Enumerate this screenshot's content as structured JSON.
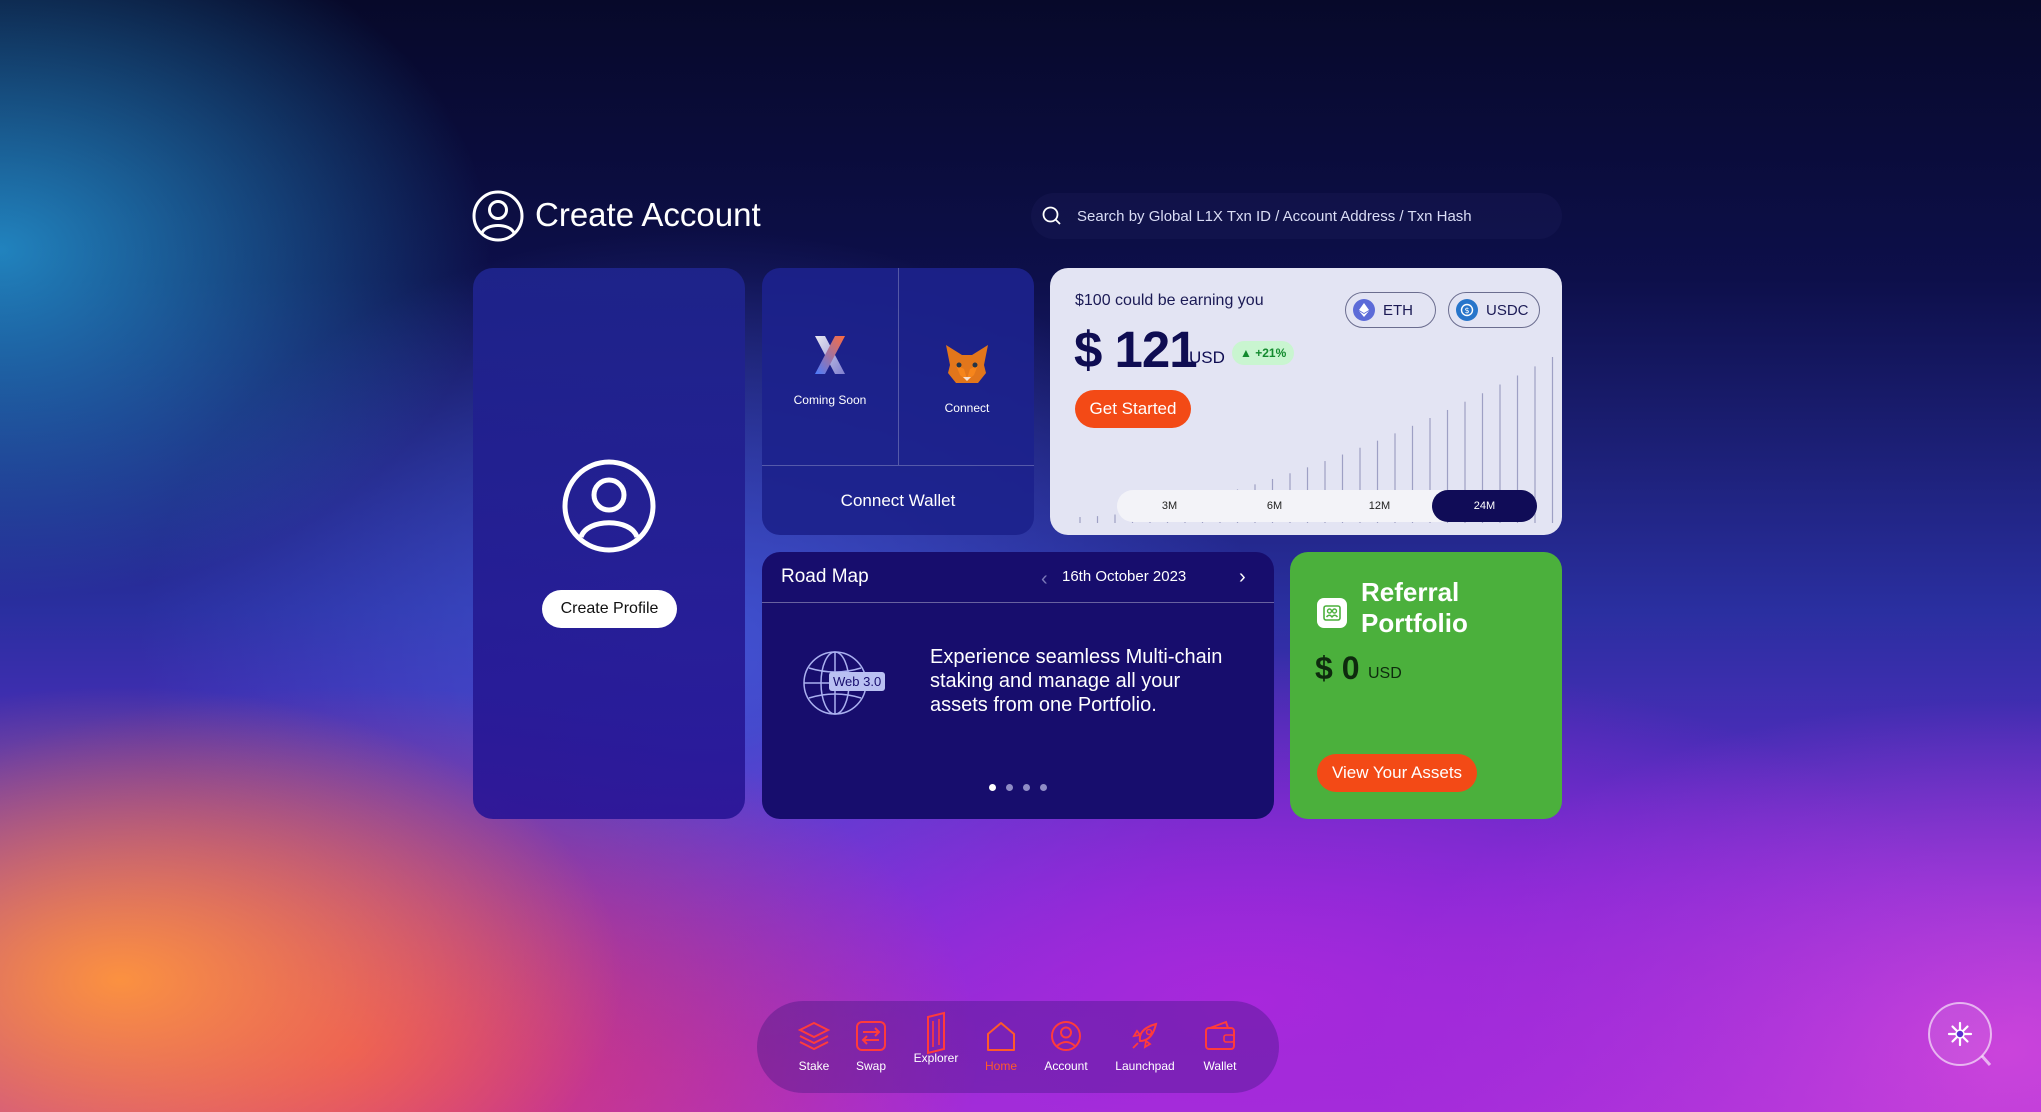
{
  "header": {
    "title": "Create Account",
    "search_placeholder": "Search by Global L1X Txn ID / Account Address / Txn Hash"
  },
  "profile_card": {
    "button_label": "Create Profile"
  },
  "wallet_card": {
    "options": [
      {
        "label": "Coming Soon",
        "icon": "l1x-logo-icon"
      },
      {
        "label": "Connect",
        "icon": "metamask-fox-icon"
      }
    ],
    "connect_label": "Connect Wallet"
  },
  "earnings_card": {
    "subtitle": "$100 could be earning you",
    "amount": "$ 121",
    "currency": "USD",
    "change": "+21%",
    "cta": "Get Started",
    "tokens": [
      {
        "label": "ETH",
        "icon": "eth-icon"
      },
      {
        "label": "USDC",
        "icon": "usdc-icon"
      }
    ],
    "periods": [
      "3M",
      "6M",
      "12M",
      "24M"
    ],
    "selected_period": "24M",
    "colors": {
      "accent": "#f34a16",
      "dark": "#100c57"
    }
  },
  "roadmap_card": {
    "title": "Road Map",
    "date": "16th October 2023",
    "badge": "Web 3.0",
    "description": "Experience seamless Multi-chain staking and manage all your assets from one Portfolio.",
    "page_count": 4,
    "active_page": 1
  },
  "referral_card": {
    "title": "Referral Portfolio",
    "amount": "$ 0",
    "currency": "USD",
    "button_label": "View Your Assets"
  },
  "dock": {
    "items": [
      {
        "label": "Stake",
        "icon": "stack-icon"
      },
      {
        "label": "Swap",
        "icon": "swap-icon"
      },
      {
        "label": "Explorer",
        "icon": "explorer-icon"
      },
      {
        "label": "Home",
        "icon": "home-icon",
        "active": true
      },
      {
        "label": "Account",
        "icon": "account-icon"
      },
      {
        "label": "Launchpad",
        "icon": "rocket-icon"
      },
      {
        "label": "Wallet",
        "icon": "wallet-icon"
      }
    ]
  }
}
